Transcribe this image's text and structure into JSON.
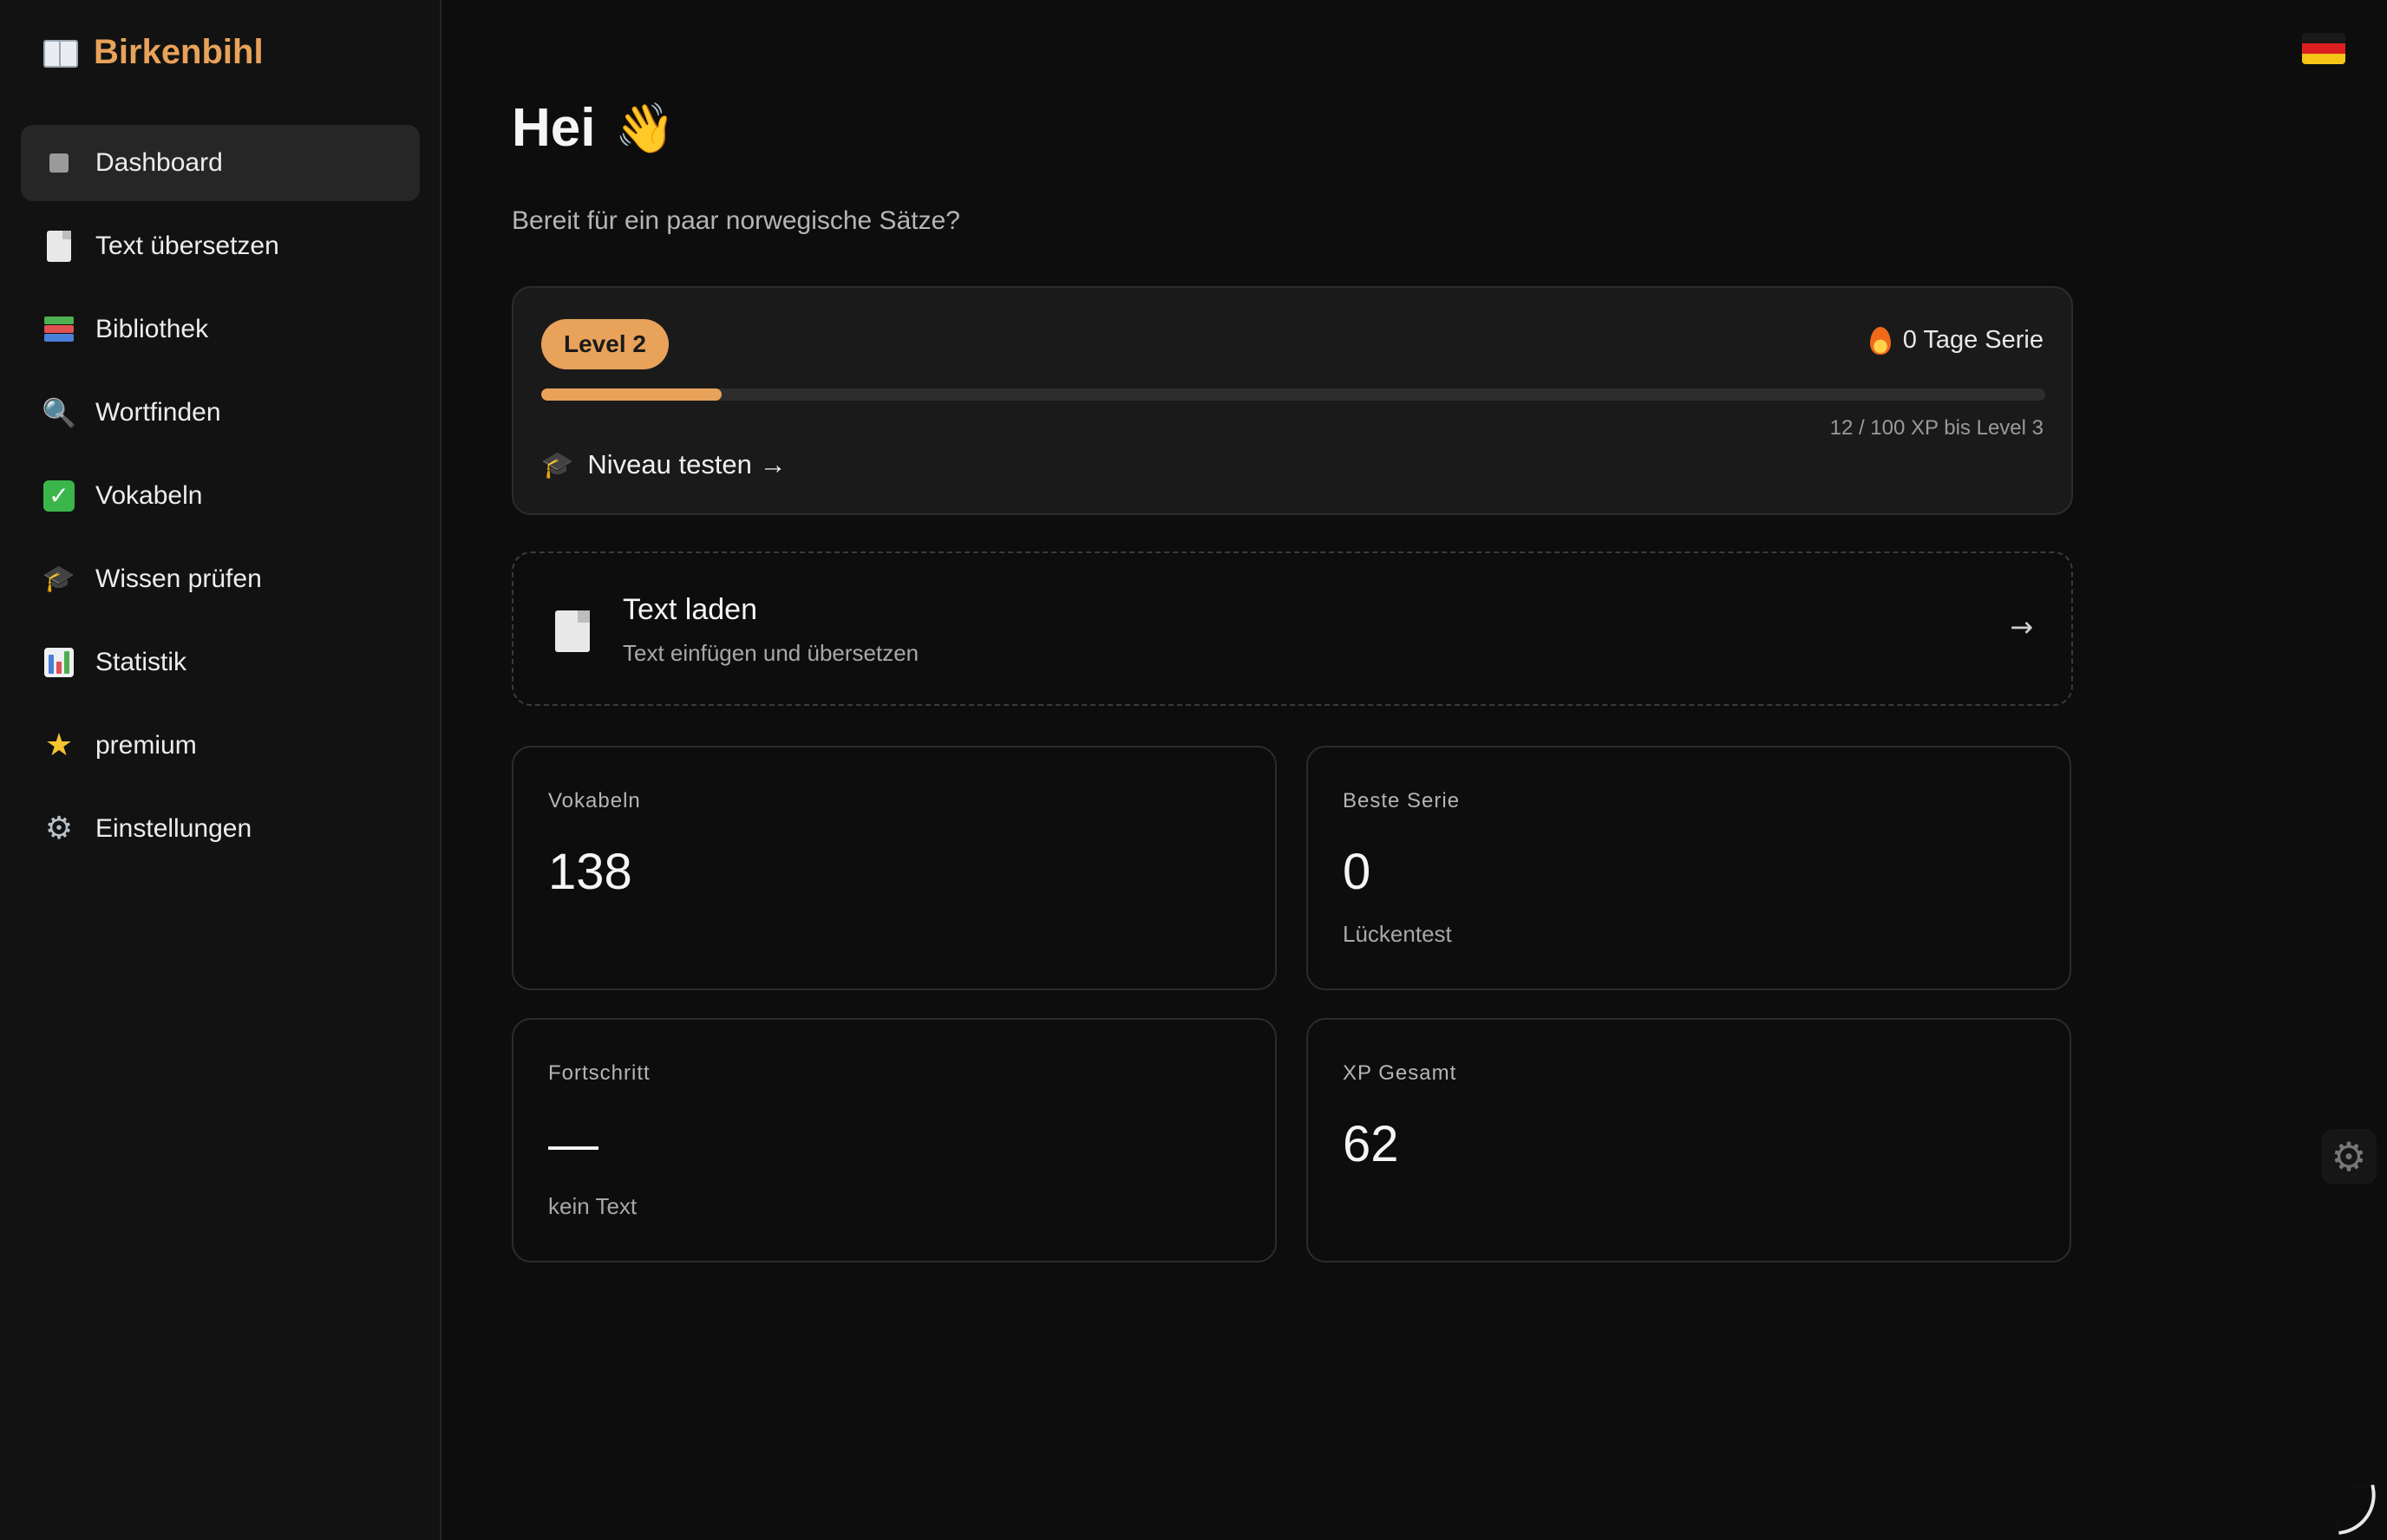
{
  "app": {
    "brand": "Birkenbihl"
  },
  "sidebar": {
    "items": [
      {
        "label": "Dashboard",
        "icon": "dashboard-icon",
        "active": true
      },
      {
        "label": "Text übersetzen",
        "icon": "document-icon"
      },
      {
        "label": "Bibliothek",
        "icon": "books-icon"
      },
      {
        "label": "Wortfinden",
        "icon": "magnifier-icon"
      },
      {
        "label": "Vokabeln",
        "icon": "checkmark-icon"
      },
      {
        "label": "Wissen prüfen",
        "icon": "graduation-cap-icon"
      },
      {
        "label": "Statistik",
        "icon": "bar-chart-icon"
      },
      {
        "label": "premium",
        "icon": "star-icon"
      },
      {
        "label": "Einstellungen",
        "icon": "gear-icon"
      }
    ]
  },
  "main": {
    "greeting": "Hei",
    "greeting_icon": "waving-hand-icon",
    "subtitle": "Bereit für ein paar norwegische Sätze?",
    "level": {
      "badge": "Level 2",
      "streak": "0 Tage Serie",
      "progress_fraction": 0.12,
      "xp_text": "12 / 100 XP bis Level 3",
      "test_link": "Niveau testen →"
    },
    "load_card": {
      "title": "Text laden",
      "subtitle": "Text einfügen und übersetzen",
      "arrow": "→"
    },
    "stats": [
      {
        "label": "Vokabeln",
        "value": "138",
        "sub": ""
      },
      {
        "label": "Beste Serie",
        "value": "0",
        "sub": "Lückentest"
      },
      {
        "label": "Fortschritt",
        "value": "—",
        "sub": "kein Text"
      },
      {
        "label": "XP Gesamt",
        "value": "62",
        "sub": ""
      }
    ]
  },
  "colors": {
    "accent": "#e8a25a",
    "background": "#0d0d0d",
    "sidebar": "#121212",
    "card": "#1a1a1a"
  },
  "language_flag": "german-flag-icon"
}
